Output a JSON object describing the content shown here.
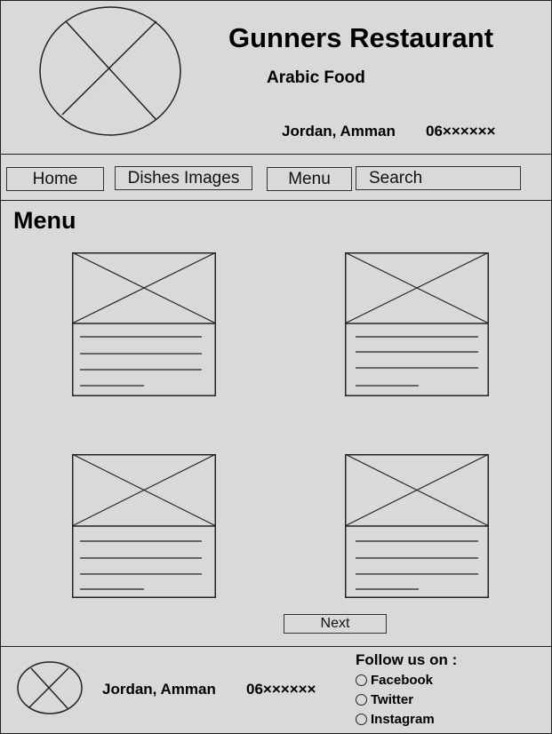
{
  "header": {
    "title": "Gunners Restaurant",
    "subtitle": "Arabic Food",
    "location": "Jordan, Amman",
    "phone": "06××××××"
  },
  "nav": {
    "home_label": "Home",
    "dishes_label": "Dishes Images",
    "menu_label": "Menu",
    "search_placeholder": "Search"
  },
  "main": {
    "heading": "Menu",
    "next_label": "Next"
  },
  "footer": {
    "location": "Jordan, Amman",
    "phone": "06××××××",
    "follow_label": "Follow us on :",
    "social": [
      "Facebook",
      "Twitter",
      "Instagram"
    ]
  },
  "icons": {
    "logo": "logo-placeholder-icon",
    "dish_image": "image-placeholder-icon"
  }
}
